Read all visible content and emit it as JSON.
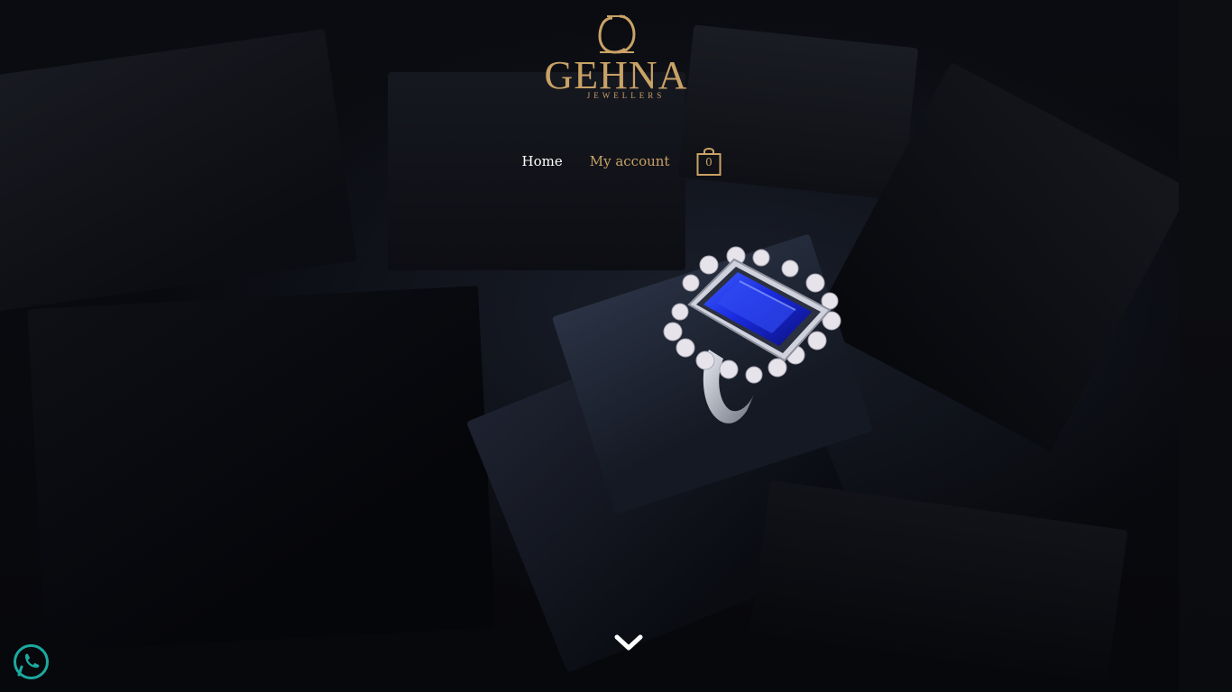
{
  "brand": {
    "name": "GEHNA",
    "subtitle": "JEWELLERS",
    "accent_color": "#c9a266"
  },
  "nav": {
    "items": [
      {
        "label": "Home",
        "color": "#ffffff"
      },
      {
        "label": "My account",
        "color": "#c9a266"
      }
    ],
    "cart": {
      "icon": "shopping-bag-icon",
      "count": "0"
    }
  },
  "hero": {
    "image": "sapphire-diamond-cocktail-ring",
    "scroll_icon": "chevron-down-icon"
  },
  "floating": {
    "whatsapp_icon": "whatsapp-icon",
    "whatsapp_color": "#1ba9a0"
  }
}
